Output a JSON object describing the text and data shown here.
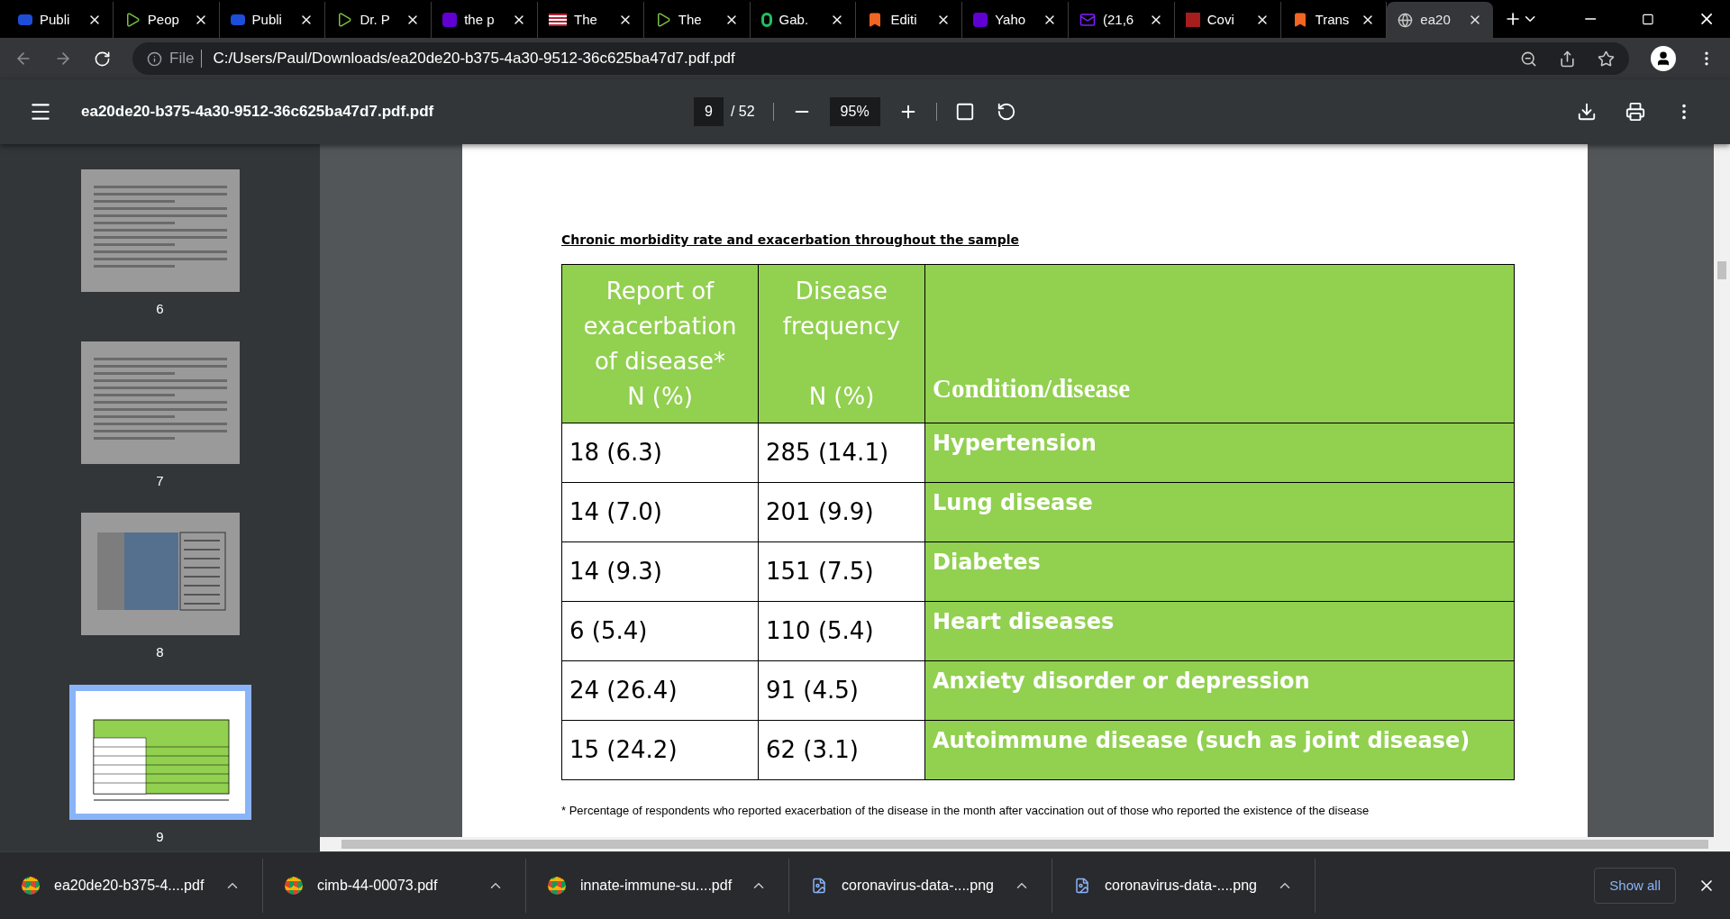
{
  "tabs": [
    {
      "title": "Publi",
      "selected": false
    },
    {
      "title": "Peop",
      "selected": false
    },
    {
      "title": "Publi",
      "selected": false
    },
    {
      "title": "Dr. P",
      "selected": false
    },
    {
      "title": "the p",
      "selected": false
    },
    {
      "title": "The",
      "selected": false
    },
    {
      "title": "The",
      "selected": false
    },
    {
      "title": "Gab.",
      "selected": false
    },
    {
      "title": "Editi",
      "selected": false
    },
    {
      "title": "Yaho",
      "selected": false
    },
    {
      "title": "(21,6",
      "selected": false
    },
    {
      "title": "Covi",
      "selected": false
    },
    {
      "title": "Trans",
      "selected": false
    },
    {
      "title": "ea20",
      "selected": true
    }
  ],
  "address": {
    "scheme": "File",
    "url": "C:/Users/Paul/Downloads/ea20de20-b375-4a30-9512-36c625ba47d7.pdf.pdf"
  },
  "viewer": {
    "filename": "ea20de20-b375-4a30-9512-36c625ba47d7.pdf.pdf",
    "page": "9",
    "total": "/ 52",
    "zoom": "95%"
  },
  "thumbnails": [
    {
      "number": "6",
      "kind": "text",
      "selected": false
    },
    {
      "number": "7",
      "kind": "text",
      "selected": false
    },
    {
      "number": "8",
      "kind": "table-blue",
      "selected": false
    },
    {
      "number": "9",
      "kind": "table-green",
      "selected": true
    }
  ],
  "document": {
    "title": "Chronic morbidity rate and exacerbation throughout the sample",
    "columns": [
      "Report of\nexacerbation\nof disease*\nN (%)",
      "Disease\nfrequency\n\nN (%)",
      "Condition/disease"
    ],
    "rows": [
      [
        "18 (6.3)",
        "285 (14.1)",
        "Hypertension"
      ],
      [
        "14 (7.0)",
        "201 (9.9)",
        "Lung disease"
      ],
      [
        "14 (9.3)",
        "151 (7.5)",
        "Diabetes"
      ],
      [
        "6 (5.4)",
        "110 (5.4)",
        "Heart diseases"
      ],
      [
        "24 (26.4)",
        "91 (4.5)",
        "Anxiety disorder or depression"
      ],
      [
        "15 (24.2)",
        "62 (3.1)",
        "Autoimmune disease (such as joint disease)"
      ]
    ],
    "footnote": "* Percentage of respondents who reported exacerbation of the disease in the month after vaccination out of those who reported the existence of the disease"
  },
  "downloads": [
    {
      "name": "ea20de20-b375-4....pdf",
      "kind": "chrome"
    },
    {
      "name": "cimb-44-00073.pdf",
      "kind": "chrome"
    },
    {
      "name": "innate-immune-su....pdf",
      "kind": "chrome"
    },
    {
      "name": "coronavirus-data-....png",
      "kind": "file"
    },
    {
      "name": "coronavirus-data-....png",
      "kind": "file"
    }
  ],
  "show_all": "Show all"
}
